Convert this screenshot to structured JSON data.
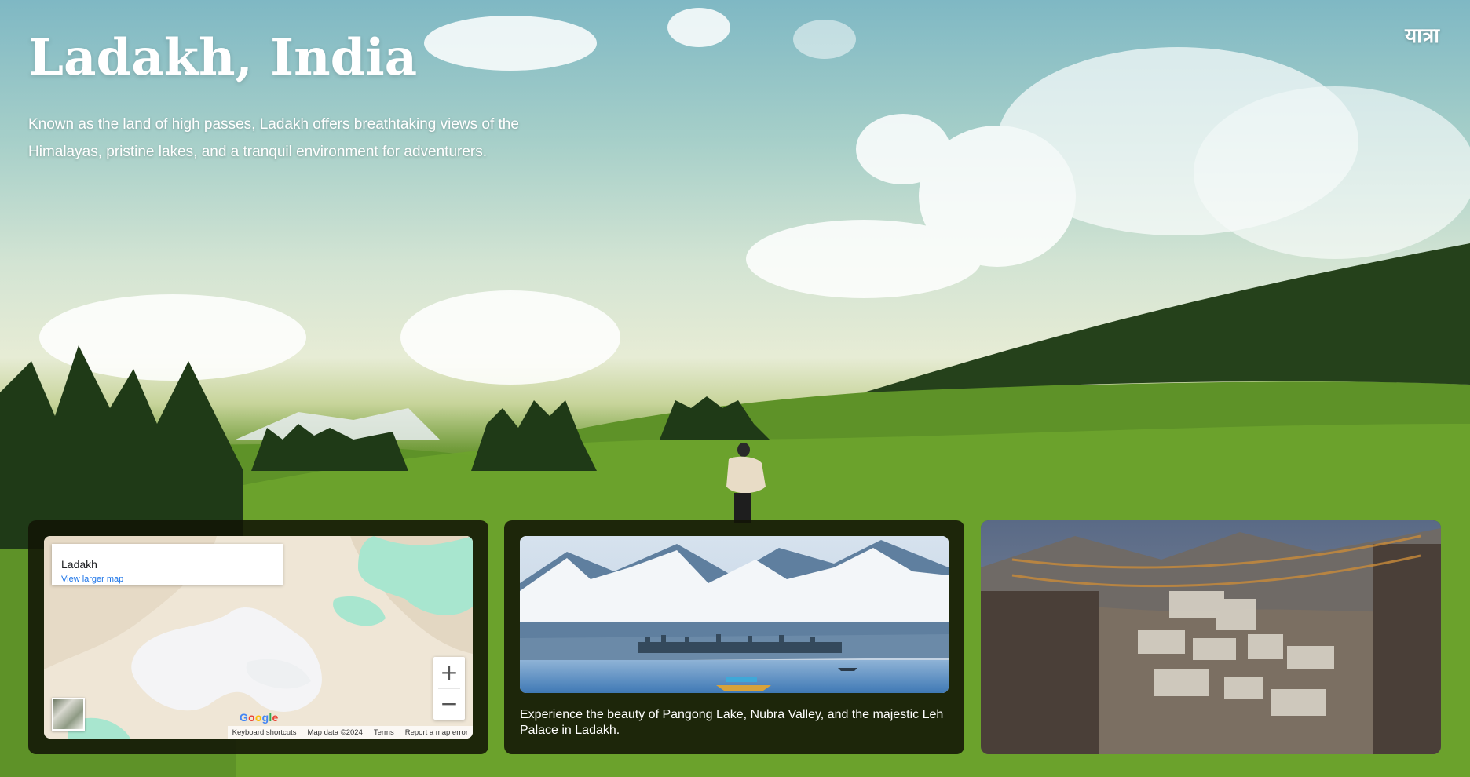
{
  "brand": {
    "logo": "यात्रा"
  },
  "hero": {
    "title": "Ladakh, India",
    "description": "Known as the land of high passes, Ladakh offers breathtaking views of the Himalayas, pristine lakes, and a tranquil environment for adventurers."
  },
  "map_card": {
    "place_name": "Ladakh",
    "view_larger": "View larger map",
    "zoom_in": "+",
    "zoom_out": "−",
    "attribution": {
      "shortcuts": "Keyboard shortcuts",
      "map_data": "Map data ©2024",
      "terms": "Terms",
      "report": "Report a map error"
    },
    "google": {
      "g1": "G",
      "o1": "o",
      "o2": "o",
      "g2": "g",
      "l": "l",
      "e": "e"
    }
  },
  "photo_card": {
    "caption": "Experience the beauty of Pangong Lake, Nubra Valley, and the majestic Leh Palace in Ladakh."
  },
  "colors": {
    "accent_link": "#1a73e8",
    "card_bg": "#121406",
    "map_land": "#efe6d6",
    "map_water": "#a8e6cf"
  }
}
